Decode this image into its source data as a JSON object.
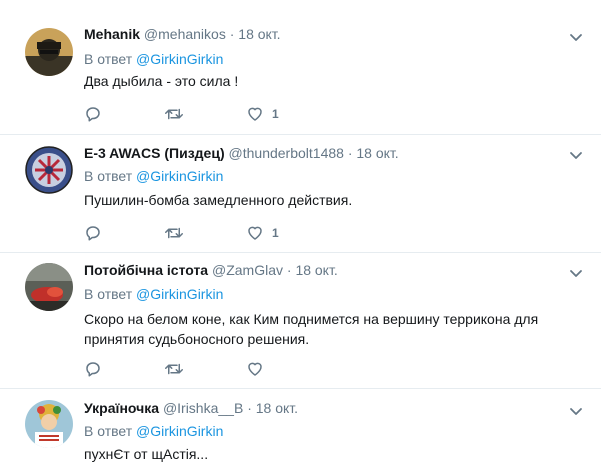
{
  "reply_label": "В ответ",
  "tweets": [
    {
      "name": "Mehanik",
      "handle": "@mehanikos",
      "sep": "·",
      "date": "18 окт.",
      "mention": "@GirkinGirkin",
      "text": "Два дыбила - это сила !",
      "like_count": "1"
    },
    {
      "name": "E-3 AWACS (Пиздец)",
      "handle": "@thunderbolt1488",
      "sep": "·",
      "date": "18 окт.",
      "mention": "@GirkinGirkin",
      "text": "Пушилин-бомба замедленного действия.",
      "like_count": "1"
    },
    {
      "name": "Потойбічна істота",
      "handle": "@ZamGlav",
      "sep": "·",
      "date": "18 окт.",
      "mention": "@GirkinGirkin",
      "text": "Скоро на белом коне, как Ким поднимется на вершину террикона для принятия судьбоносного решения.",
      "like_count": ""
    },
    {
      "name": "Україночка",
      "handle": "@Irishka__B",
      "sep": "·",
      "date": "18 окт.",
      "mention": "@GirkinGirkin",
      "text": "пухнЄт от щАстія...",
      "like_count": ""
    }
  ],
  "icons": {
    "reply": "reply-icon",
    "retweet": "retweet-icon",
    "like": "heart-icon",
    "menu": "chevron-down-icon"
  },
  "colors": {
    "link": "#1b95e0",
    "muted": "#657786",
    "text": "#14171a",
    "divider": "#e6ecf0"
  }
}
